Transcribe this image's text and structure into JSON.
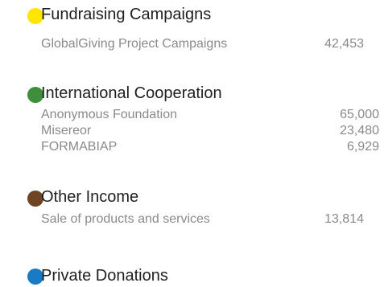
{
  "sections": [
    {
      "title": "Fundraising Campaigns",
      "color": "#ffe600",
      "items": [
        {
          "label": "GlobalGiving Project Campaigns",
          "value": "42,453"
        }
      ]
    },
    {
      "title": "International Cooperation",
      "color": "#3e8e3c",
      "items": [
        {
          "label": "Anonymous Foundation",
          "value": "65,000"
        },
        {
          "label": "Misereor",
          "value": "23,480"
        },
        {
          "label": "FORMABIAP",
          "value": "6,929"
        }
      ]
    },
    {
      "title": "Other Income",
      "color": "#6e4422",
      "items": [
        {
          "label": "Sale of products and services",
          "value": "13,814"
        }
      ]
    },
    {
      "title": "Private Donations",
      "color": "#1a7ac4",
      "items": []
    }
  ]
}
